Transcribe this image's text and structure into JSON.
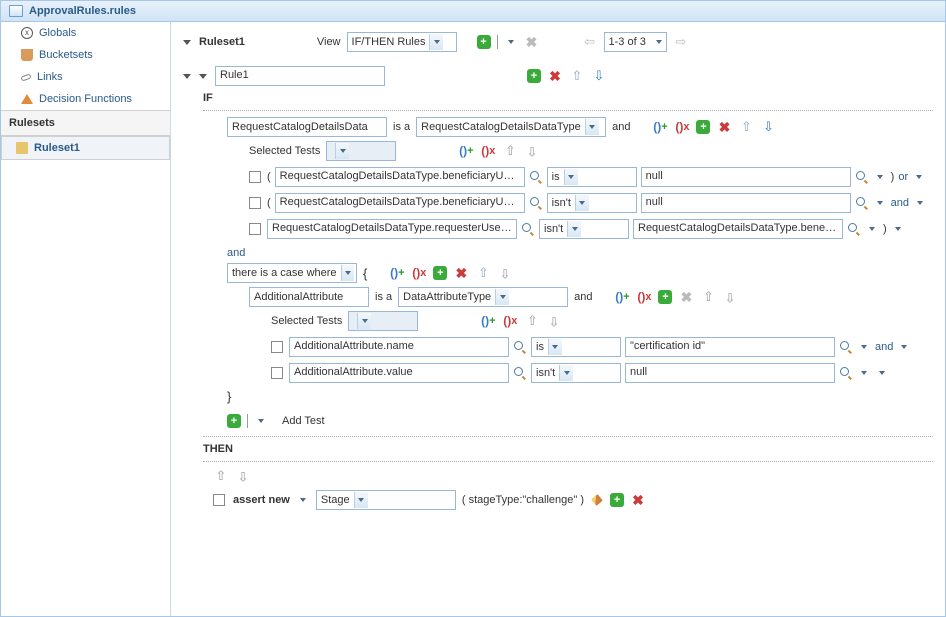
{
  "title": "ApprovalRules.rules",
  "sidebar": {
    "items": [
      {
        "label": "Globals"
      },
      {
        "label": "Bucketsets"
      },
      {
        "label": "Links"
      },
      {
        "label": "Decision Functions"
      }
    ],
    "rulesets_heading": "Rulesets",
    "ruleset_item": "Ruleset1"
  },
  "toolbar": {
    "ruleset_label": "Ruleset1",
    "view_label": "View",
    "view_value": "IF/THEN Rules",
    "page_info": "1-3 of 3"
  },
  "rule_header": {
    "name": "Rule1"
  },
  "if": {
    "label": "IF",
    "subject": "RequestCatalogDetailsData",
    "is_a": "is a",
    "type": "RequestCatalogDetailsDataType",
    "and_text": "and",
    "selected_tests": "Selected Tests",
    "conds": [
      {
        "paren": "(",
        "lhs": "RequestCatalogDetailsDataType.beneficiaryUserDat",
        "op": "is",
        "rhs": "null",
        "cparen": ")",
        "join": "or"
      },
      {
        "paren": "(",
        "lhs": "RequestCatalogDetailsDataType.beneficiaryUserDat",
        "op": "isn't",
        "rhs": "null",
        "cparen": "",
        "join": "and"
      },
      {
        "paren": "",
        "lhs": "RequestCatalogDetailsDataType.requesterUserData",
        "op": "isn't",
        "rhs": "RequestCatalogDetailsDataType.beneficiaryUserDat",
        "cparen": ")",
        "join": ""
      }
    ],
    "and_block": "and",
    "case_where": "there is a case where",
    "inner": {
      "subject": "AdditionalAttribute",
      "type": "DataAttributeType",
      "conds": [
        {
          "lhs": "AdditionalAttribute.name",
          "op": "is",
          "rhs": "\"certification id\"",
          "join": "and"
        },
        {
          "lhs": "AdditionalAttribute.value",
          "op": "isn't",
          "rhs": "null",
          "join": ""
        }
      ]
    },
    "add_test": "Add Test"
  },
  "then": {
    "label": "THEN",
    "action": "assert new",
    "target": "Stage",
    "params": "( stageType:\"challenge\" )"
  }
}
